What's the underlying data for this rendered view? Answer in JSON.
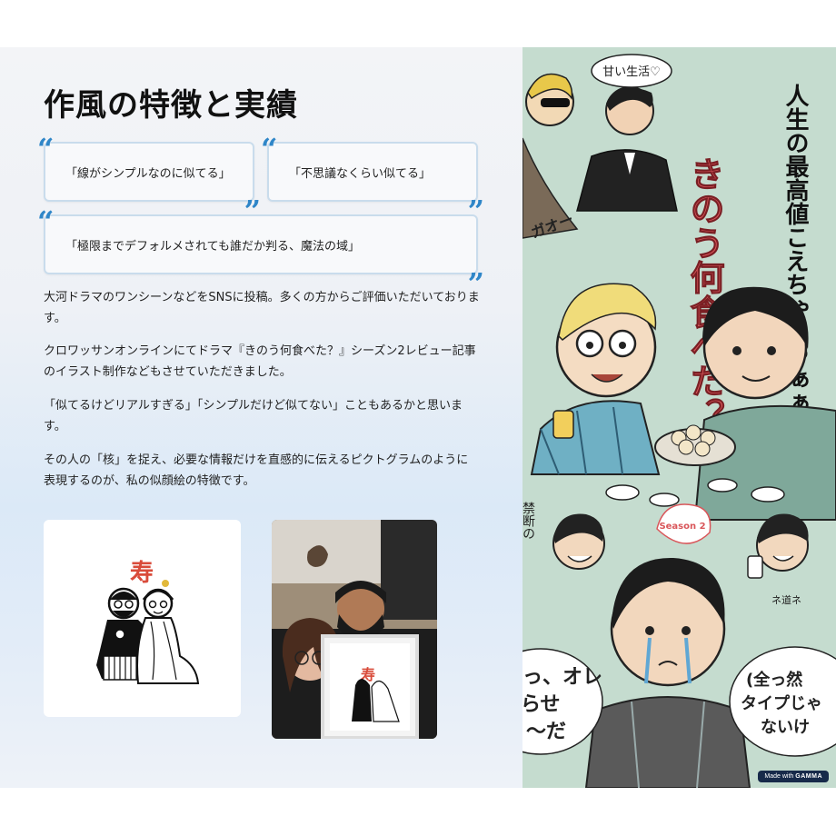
{
  "title": "作風の特徴と実績",
  "quotes": [
    "「線がシンプルなのに似てる」",
    "「不思議なくらい似てる」",
    "「極限までデフォルメされても誰だか判る、魔法の域」"
  ],
  "paragraphs": [
    "大河ドラマのワンシーンなどをSNSに投稿。多くの方からご評価いただいております。",
    "クロワッサンオンラインにてドラマ『きのう何食べた？』シーズン2レビュー記事のイラスト制作などもさせていただきました。",
    "「似てるけどリアルすぎる」「シンプルだけど似てない」こともあるかと思います。",
    "その人の「核」を捉え、必要な情報だけを直感的に伝えるピクトグラムのように表現するのが、私の似顔絵の特徴です。"
  ],
  "illustration": {
    "kotobuki": "寿",
    "title_vertical": "きのう何食べた？",
    "catch_vertical": "人生の最高値こえちゃうやぁぁ",
    "bubble_top": "甘い生活♡",
    "bubble_gao": "ガオー",
    "bubble_kindan": "禁断の",
    "bubble_season": "Season 2",
    "bubble_michi": "ネ道ネ",
    "bubble_ore": "っ、オレ\nらせ\n〜だ",
    "bubble_zenzen": "(全っ然\nタイプじゃ\nないけ"
  },
  "badge": {
    "prefix": "Made with",
    "brand": "GAMMA"
  },
  "colors": {
    "accent_quote": "#2f86c8",
    "card_border": "#c9dcec",
    "illustration_bg": "#c7ddd0",
    "badge_bg": "#172a4a"
  }
}
